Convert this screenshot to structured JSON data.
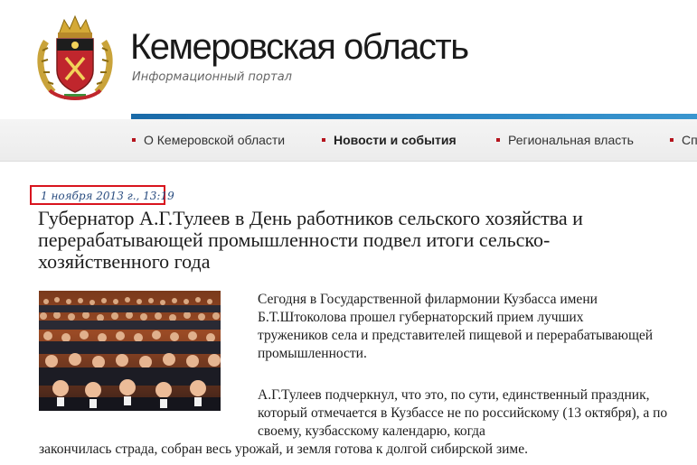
{
  "header": {
    "site_title": "Кемеровская область",
    "site_subtitle": "Информационный портал"
  },
  "nav": {
    "items": [
      {
        "label": "О Кемеровской области"
      },
      {
        "label": "Новости и события",
        "active": true
      },
      {
        "label": "Региональная власть"
      },
      {
        "label": "Сп"
      }
    ]
  },
  "article": {
    "date": "1 ноября 2013 г., 13:19",
    "headline": "Губернатор А.Г.Тулеев в День работников сельского хозяйства и перерабатывающей промышленности подвел итоги сельско-хозяйственного года",
    "paragraphs": [
      "Сегодня в Государственной филармонии Кузбасса имени Б.Т.Штоколова  прошел губернаторский прием лучших тружеников села и представителей пищевой и перерабатывающей промышленности.",
      "А.Г.Тулеев подчеркнул, что это, по сути, единственный праздник, который отмечается в Кузбассе не по российскому (13 октября), а по своему, кузбасскому календарю, когда",
      "закончилась страда, собран весь урожай, и земля готова к долгой сибирской зиме."
    ]
  },
  "colors": {
    "accent_red": "#d8141e",
    "nav_bullet": "#b5141d",
    "blue_line": "#2a86c4",
    "date_text": "#2a4d80"
  },
  "icons": {
    "emblem": "kemerovo-coat-of-arms-icon",
    "photo": "audience-photo"
  }
}
